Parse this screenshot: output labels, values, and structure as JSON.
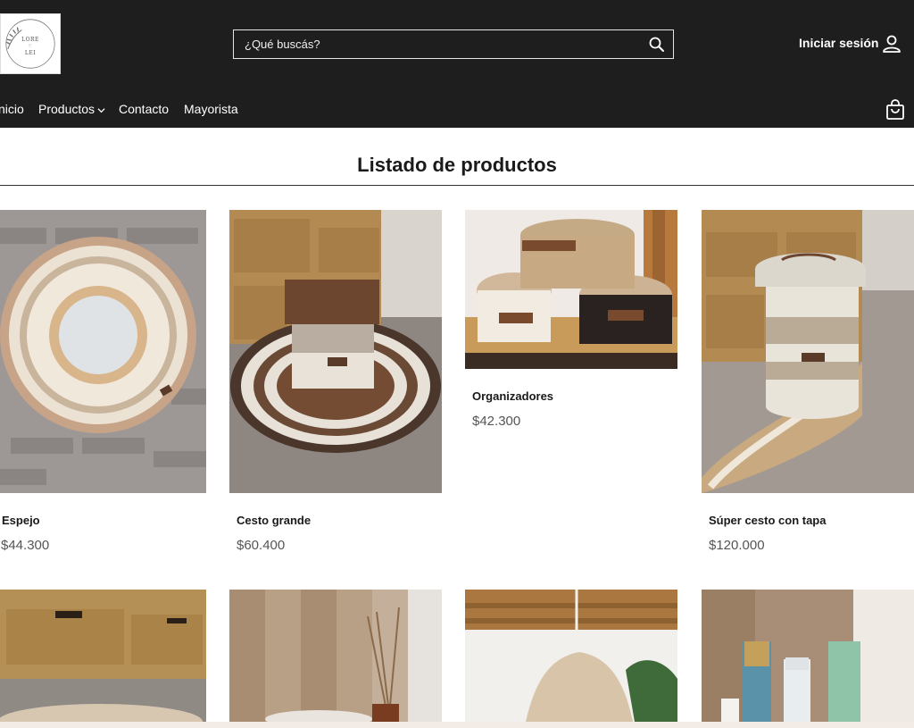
{
  "header": {
    "logo": {
      "line1": "LORE",
      "line2": "♡",
      "line3": "LEI"
    },
    "search": {
      "placeholder": "¿Qué buscás?"
    },
    "login_label": "Iniciar sesión"
  },
  "nav": {
    "items": [
      {
        "label": "nicio"
      },
      {
        "label": "Productos"
      },
      {
        "label": "Contacto"
      },
      {
        "label": "Mayorista"
      }
    ]
  },
  "page": {
    "title": "Listado de productos"
  },
  "products": [
    {
      "name": "Espejo",
      "price": "$44.300"
    },
    {
      "name": "Cesto grande",
      "price": "$60.400"
    },
    {
      "name": "Organizadores",
      "price": "$42.300"
    },
    {
      "name": "Súper cesto con tapa",
      "price": "$120.000"
    }
  ],
  "colors": {
    "header_bg": "#1e1e1e",
    "accent_text": "#ffffff",
    "price_text": "#555555"
  }
}
